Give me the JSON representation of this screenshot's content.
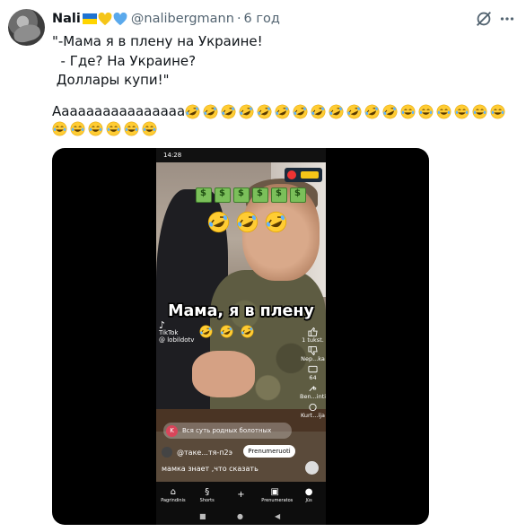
{
  "tweet": {
    "display_name": "Nali",
    "handle": "@nalibergmann",
    "separator": "·",
    "time": "6 год",
    "text_lines": "\"-Мама я в плену на Украине!\n  - Где? На Украине?\n Доллары купи!\"",
    "second_line_prefix": "Аааааааааааааааа",
    "emoji_row1": [
      "rolling-laugh-icon",
      "rolling-laugh-icon",
      "rolling-laugh-icon",
      "rolling-laugh-icon",
      "rolling-laugh-icon",
      "rolling-laugh-icon",
      "rolling-laugh-icon",
      "rolling-laugh-icon",
      "rolling-laugh-icon",
      "rolling-laugh-icon",
      "rolling-laugh-icon",
      "rolling-laugh-icon",
      "grin-sweat-icon",
      "grin-sweat-icon",
      "grin-sweat-icon",
      "grin-sweat-icon",
      "grin-sweat-icon",
      "grin-sweat-icon"
    ],
    "emoji_row2": [
      "grin-sweat-icon",
      "grin-sweat-icon",
      "grin-sweat-icon",
      "grin-sweat-icon",
      "grin-sweat-icon",
      "grin-sweat-icon"
    ]
  },
  "video": {
    "status_time": "14:28",
    "caption": "Мама, я в плену",
    "tiktok_label": "TikTok",
    "tiktok_user": "@ lobildotv",
    "likes": "1 tukst.",
    "dislike_label": "Nep...ka",
    "comments": "64",
    "share_label": "Ben...inti",
    "remix_label": "Kurt...ija",
    "comment_prompt_badge": "K",
    "comment_prompt": "Вся суть родных болотных",
    "channel_name": "@таке...тя-п2э",
    "subscribe_label": "Prenumeruoti",
    "description": "мамка знает ,что сказать",
    "nav": [
      {
        "label": "Pagrindinis",
        "glyph": "⌂"
      },
      {
        "label": "Shorts",
        "glyph": "§"
      },
      {
        "label": "",
        "glyph": "+"
      },
      {
        "label": "Prenumeratos",
        "glyph": "▣"
      },
      {
        "label": "Jūs",
        "glyph": "●"
      }
    ],
    "sysnav": [
      "■",
      "●",
      "◀"
    ]
  },
  "colors": {
    "handle_gray": "#536471",
    "flag_blue": "#1f73d2",
    "flag_yellow": "#ffd500",
    "heart_yellow": "#f5c518",
    "heart_blue": "#5aa9ec"
  }
}
